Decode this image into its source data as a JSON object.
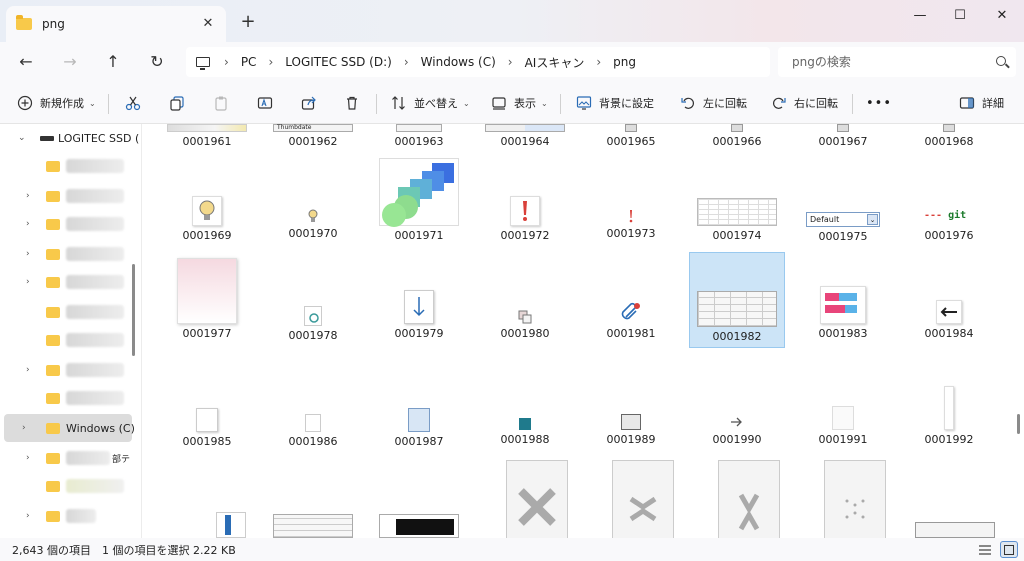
{
  "window": {
    "tab_title": "png",
    "tab_close": "✕",
    "new_tab": "+",
    "minimize": "—",
    "maximize": "☐",
    "close": "✕"
  },
  "nav": {
    "back": "←",
    "forward": "→",
    "up": "↑",
    "refresh": "↻",
    "breadcrumbs": [
      "PC",
      "LOGITEC SSD (D:)",
      "Windows (C)",
      "AIスキャン",
      "png"
    ],
    "separator": "›",
    "search_placeholder": "pngの検索"
  },
  "commands": {
    "new": "新規作成",
    "sort": "並べ替え",
    "view": "表示",
    "set_background": "背景に設定",
    "rotate_left": "左に回転",
    "rotate_right": "右に回転",
    "more": "•••",
    "details": "詳細"
  },
  "sidebar": {
    "drive": "LOGITEC SSD (",
    "selected_folder": "Windows (C)",
    "partial_label": "部テ"
  },
  "files": {
    "row1": [
      "0001961",
      "0001962",
      "0001963",
      "0001964",
      "0001965",
      "0001966",
      "0001967",
      "0001968"
    ],
    "row2": [
      "0001969",
      "0001970",
      "0001971",
      "0001972",
      "0001973",
      "0001974",
      "0001975",
      "0001976"
    ],
    "row3": [
      "0001977",
      "0001978",
      "0001979",
      "0001980",
      "0001981",
      "0001982",
      "0001983",
      "0001984"
    ],
    "row4": [
      "0001985",
      "0001986",
      "0001987",
      "0001988",
      "0001989",
      "0001990",
      "0001991",
      "0001992"
    ],
    "selected": "0001982",
    "thumb_text": {
      "default_dropdown": "Default",
      "git_label": "git",
      "thumb1962": "Thumbdate"
    }
  },
  "status": {
    "count": "2,643 個の項目",
    "selection": "1 個の項目を選択  2.22 KB"
  },
  "colors": {
    "accent": "#0067c0",
    "selection": "#cce4f7",
    "folder": "#f8c94a"
  }
}
